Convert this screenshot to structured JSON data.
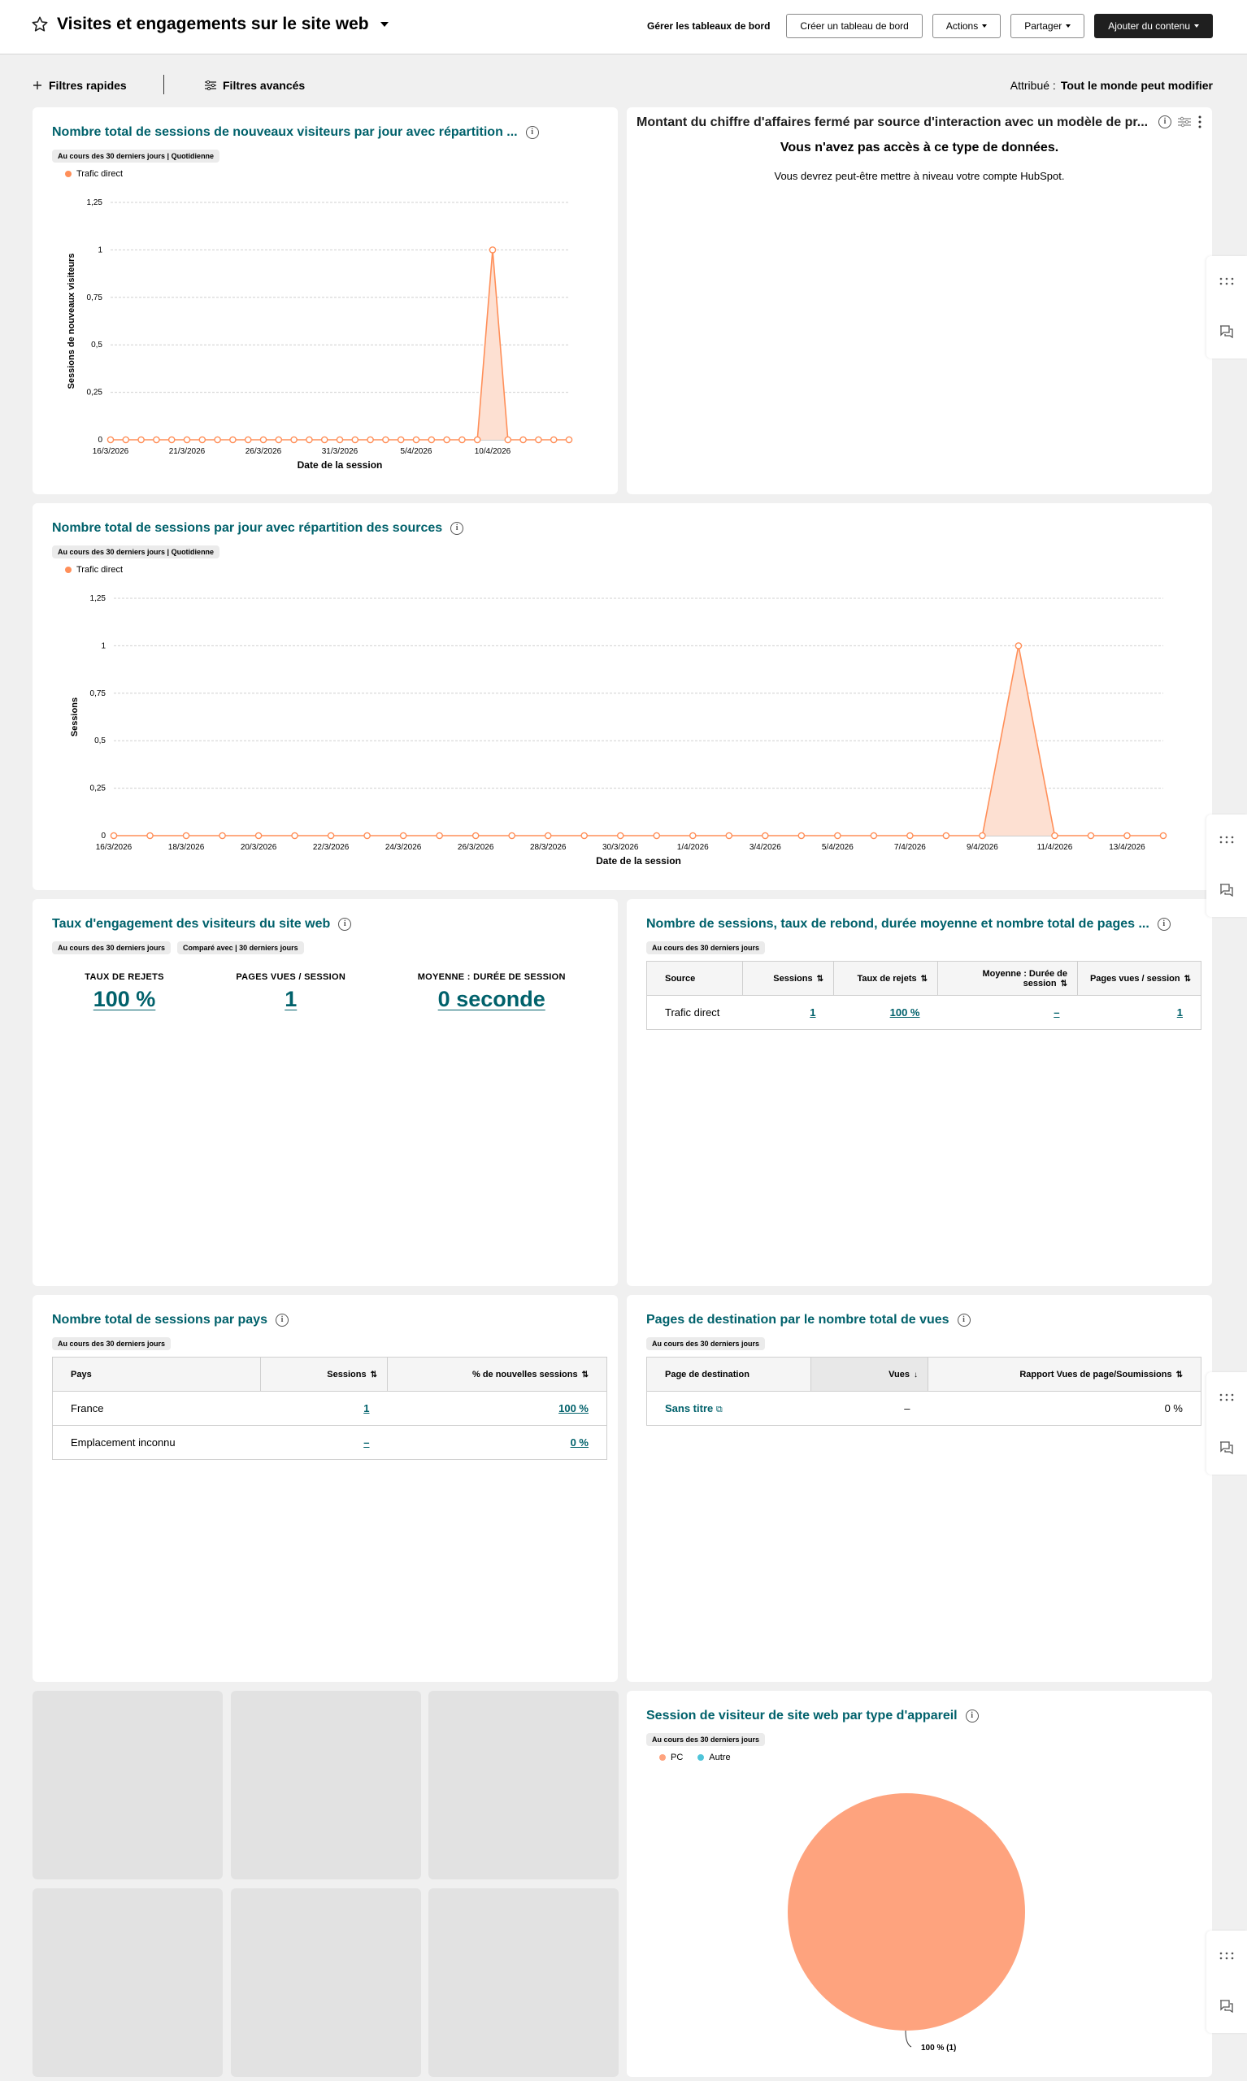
{
  "header": {
    "title": "Visites et engagements sur le site web",
    "manage_label": "Gérer les tableaux de bord",
    "create_label": "Créer un tableau de bord",
    "actions_label": "Actions",
    "share_label": "Partager",
    "add_content_label": "Ajouter du contenu"
  },
  "filters": {
    "quick_label": "Filtres rapides",
    "advanced_label": "Filtres avancés",
    "assigned_label": "Attribué :",
    "assigned_value": "Tout le monde peut modifier"
  },
  "cards": {
    "new_sessions": {
      "title": "Nombre total de sessions de nouveaux visiteurs par jour avec répartition ...",
      "tag": "Au cours des 30 derniers jours | Quotidienne"
    },
    "revenue": {
      "title": "Montant du chiffre d'affaires fermé par source d'interaction avec un modèle de pr...",
      "heading": "Vous n'avez pas accès à ce type de données.",
      "message": "Vous devrez peut-être mettre à niveau votre compte HubSpot."
    },
    "sessions": {
      "title": "Nombre total de sessions par jour avec répartition des sources",
      "tag": "Au cours des 30 derniers jours | Quotidienne"
    },
    "engagement": {
      "title": "Taux d'engagement des visiteurs du site web",
      "tag1": "Au cours des 30 derniers jours",
      "tag2": "Comparé avec | 30 derniers jours",
      "kpis": [
        {
          "label": "TAUX DE REJETS",
          "value": "100 %"
        },
        {
          "label": "PAGES VUES / SESSION",
          "value": "1"
        },
        {
          "label": "MOYENNE : DURÉE DE SESSION",
          "value": "0 seconde"
        }
      ]
    },
    "sources_table": {
      "title": "Nombre de sessions, taux de rebond, durée moyenne et nombre total de pages ...",
      "tag": "Au cours des 30 derniers jours",
      "headers": [
        "Source",
        "Sessions",
        "Taux de rejets",
        "Moyenne : Durée de session",
        "Pages vues / session"
      ],
      "rows": [
        [
          "Trafic direct",
          "1",
          "100 %",
          "–",
          "1"
        ]
      ]
    },
    "countries": {
      "title": "Nombre total de sessions par pays",
      "tag": "Au cours des 30 derniers jours",
      "headers": [
        "Pays",
        "Sessions",
        "% de nouvelles sessions"
      ],
      "rows": [
        [
          "France",
          "1",
          "100 %"
        ],
        [
          "Emplacement inconnu",
          "–",
          "0 %"
        ]
      ]
    },
    "landing_pages": {
      "title": "Pages de destination par le nombre total de vues",
      "tag": "Au cours des 30 derniers jours",
      "headers": [
        "Page de destination",
        "Vues",
        "Rapport Vues de page/Soumissions"
      ],
      "rows": [
        [
          "Sans titre",
          "–",
          "0 %"
        ]
      ]
    },
    "devices": {
      "title": "Session de visiteur de site web par type d'appareil",
      "tag": "Au cours des 30 derniers jours"
    }
  },
  "colors": {
    "accent": "#00616b",
    "series": "#ff8f59",
    "series_fill": "#fde0d2",
    "pc": "#fea37e",
    "other": "#4fc4d9"
  },
  "chart_data": [
    {
      "type": "area",
      "legend": [
        "Trafic direct"
      ],
      "xlabel": "Date de la session",
      "ylabel": "Sessions de nouveaux visiteurs",
      "ylim": [
        0,
        1.25
      ],
      "yticks": [
        "0",
        "0,25",
        "0,5",
        "0,75",
        "1",
        "1,25"
      ],
      "xticks": [
        "16/3/2026",
        "21/3/2026",
        "26/3/2026",
        "31/3/2026",
        "5/4/2026",
        "10/4/2026"
      ],
      "series": [
        {
          "name": "Trafic direct",
          "values": [
            0,
            0,
            0,
            0,
            0,
            0,
            0,
            0,
            0,
            0,
            0,
            0,
            0,
            0,
            0,
            0,
            0,
            0,
            0,
            0,
            0,
            0,
            0,
            0,
            0,
            1,
            0,
            0,
            0,
            0,
            0
          ]
        }
      ]
    },
    {
      "type": "area",
      "legend": [
        "Trafic direct"
      ],
      "xlabel": "Date de la session",
      "ylabel": "Sessions",
      "ylim": [
        0,
        1.25
      ],
      "yticks": [
        "0",
        "0,25",
        "0,5",
        "0,75",
        "1",
        "1,25"
      ],
      "xticks": [
        "16/3/2026",
        "18/3/2026",
        "20/3/2026",
        "22/3/2026",
        "24/3/2026",
        "26/3/2026",
        "28/3/2026",
        "30/3/2026",
        "1/4/2026",
        "3/4/2026",
        "5/4/2026",
        "7/4/2026",
        "9/4/2026",
        "11/4/2026",
        "13/4/2026"
      ],
      "series": [
        {
          "name": "Trafic direct",
          "values": [
            0,
            0,
            0,
            0,
            0,
            0,
            0,
            0,
            0,
            0,
            0,
            0,
            0,
            0,
            0,
            0,
            0,
            0,
            0,
            0,
            0,
            0,
            0,
            0,
            0,
            1,
            0,
            0,
            0,
            0
          ]
        }
      ]
    },
    {
      "type": "pie",
      "legend": [
        "PC",
        "Autre"
      ],
      "slices": [
        {
          "name": "PC",
          "value": 1,
          "label": "100 % (1)"
        },
        {
          "name": "Autre",
          "value": 0
        }
      ]
    }
  ]
}
